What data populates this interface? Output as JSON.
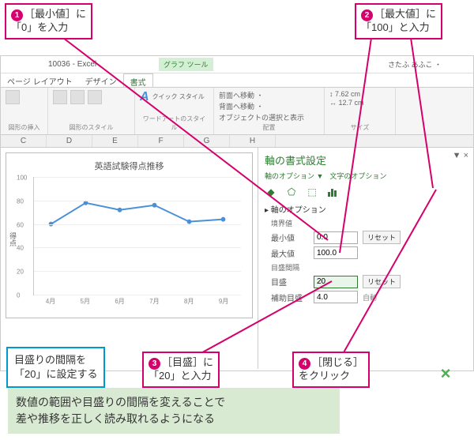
{
  "callouts": {
    "c1": {
      "num": "1",
      "text": "［最小値］に\n「0」を入力"
    },
    "c2": {
      "num": "2",
      "text": "［最大値］に\n「100」と入力"
    },
    "c3": {
      "num": "3",
      "text": "［目盛］に\n「20」と入力"
    },
    "c4": {
      "num": "4",
      "text": "［閉じる］\nをクリック"
    }
  },
  "bluebox": "目盛りの間隔を\n「20」に設定する",
  "tip": "数値の範囲や目盛りの間隔を変えることで\n差や推移を正しく読み取れるようになる",
  "titlebar": {
    "doc": "10036 - Excel",
    "tools": "グラフ ツール",
    "user": "さたふ あふこ ・"
  },
  "tabs": {
    "layout": "ページ レイアウト",
    "design": "デザイン",
    "format": "書式"
  },
  "ribbon": {
    "g1": "図形の挿入",
    "g2": "図形のスタイル",
    "g3b": "クイック\nスタイル",
    "g3": "ワードアートのスタイル",
    "g4a": "前面へ移動 ・",
    "g4b": "背面へ移動 ・",
    "g4c": "オブジェクトの選択と表示",
    "g4": "配置",
    "g5a": "7.62 cm",
    "g5b": "12.7 cm",
    "g5": "サイズ"
  },
  "columns": [
    "C",
    "D",
    "E",
    "F",
    "G",
    "H"
  ],
  "chart": {
    "title": "英語試験得点推移",
    "axis_title": "得点"
  },
  "chart_data": {
    "type": "line",
    "categories": [
      "4月",
      "5月",
      "6月",
      "7月",
      "8月",
      "9月"
    ],
    "values": [
      60,
      78,
      72,
      76,
      62,
      64
    ],
    "title": "英語試験得点推移",
    "xlabel": "",
    "ylabel": "得点",
    "ylim": [
      0,
      100
    ],
    "ytick": 20
  },
  "pane": {
    "title": "軸の書式設定",
    "sub1": "軸のオプション ▼",
    "sub2": "文字のオプション",
    "section": "▸ 軸のオプション",
    "bounds": "境界値",
    "min_lbl": "最小値",
    "min_val": "0.0",
    "reset": "リセット",
    "max_lbl": "最大値",
    "max_val": "100.0",
    "units": "目盛間隔",
    "major_lbl": "目盛",
    "major_val": "20",
    "minor_lbl": "補助目盛",
    "minor_val": "4.0",
    "auto": "自動"
  }
}
